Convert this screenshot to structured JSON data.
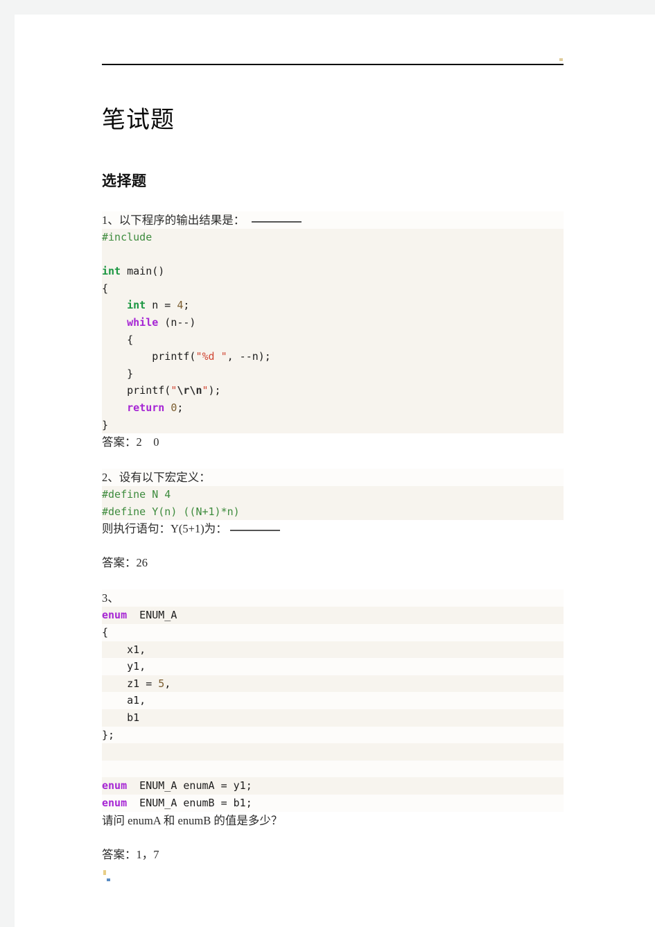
{
  "document": {
    "title": "笔试题",
    "section_title": "选择题"
  },
  "questions": [
    {
      "prompt_text": "1、以下程序的输出结果是：",
      "answer_label": "答案：2　0",
      "code": [
        [
          {
            "t": "#include",
            "c": "k-pre"
          }
        ],
        [
          {
            "t": "",
            "c": "k-plain"
          }
        ],
        [
          {
            "t": "int",
            "c": "k-type"
          },
          {
            "t": " main()",
            "c": "k-plain"
          }
        ],
        [
          {
            "t": "{",
            "c": "k-plain"
          }
        ],
        [
          {
            "t": "    ",
            "c": "k-plain"
          },
          {
            "t": "int",
            "c": "k-type"
          },
          {
            "t": " n = ",
            "c": "k-plain"
          },
          {
            "t": "4",
            "c": "k-num"
          },
          {
            "t": ";",
            "c": "k-plain"
          }
        ],
        [
          {
            "t": "    ",
            "c": "k-plain"
          },
          {
            "t": "while",
            "c": "k-kw"
          },
          {
            "t": " (n--)",
            "c": "k-plain"
          }
        ],
        [
          {
            "t": "    {",
            "c": "k-plain"
          }
        ],
        [
          {
            "t": "        printf(",
            "c": "k-plain"
          },
          {
            "t": "\"%d \"",
            "c": "k-str"
          },
          {
            "t": ", --n);",
            "c": "k-plain"
          }
        ],
        [
          {
            "t": "    }",
            "c": "k-plain"
          }
        ],
        [
          {
            "t": "    printf(",
            "c": "k-plain"
          },
          {
            "t": "\"",
            "c": "k-str"
          },
          {
            "t": "\\r\\n",
            "c": "k-esc"
          },
          {
            "t": "\"",
            "c": "k-str"
          },
          {
            "t": ");",
            "c": "k-plain"
          }
        ],
        [
          {
            "t": "    ",
            "c": "k-plain"
          },
          {
            "t": "return",
            "c": "k-kw"
          },
          {
            "t": " ",
            "c": "k-plain"
          },
          {
            "t": "0",
            "c": "k-num"
          },
          {
            "t": ";",
            "c": "k-plain"
          }
        ],
        [
          {
            "t": "}",
            "c": "k-plain"
          }
        ]
      ]
    },
    {
      "prompt_text": "2、设有以下宏定义：",
      "prompt_after": "则执行语句：Y(5+1)为：",
      "answer_label": "答案：26",
      "code": [
        [
          {
            "t": "#define N 4",
            "c": "k-pre"
          }
        ],
        [
          {
            "t": "#define Y(n) ((N+1)*n)",
            "c": "k-pre"
          }
        ]
      ]
    },
    {
      "prompt_text": "3、",
      "prompt_after": "请问 enumA 和 enumB 的值是多少？",
      "answer_label": "答案：1，7",
      "code": [
        [
          {
            "t": "enum",
            "c": "k-kw"
          },
          {
            "t": "  ENUM_A",
            "c": "k-plain"
          }
        ],
        [
          {
            "t": "{",
            "c": "k-plain"
          }
        ],
        [
          {
            "t": "    x1,",
            "c": "k-plain"
          }
        ],
        [
          {
            "t": "    y1,",
            "c": "k-plain"
          }
        ],
        [
          {
            "t": "    z1 = ",
            "c": "k-plain"
          },
          {
            "t": "5",
            "c": "k-num"
          },
          {
            "t": ",",
            "c": "k-plain"
          }
        ],
        [
          {
            "t": "    a1,",
            "c": "k-plain"
          }
        ],
        [
          {
            "t": "    b1",
            "c": "k-plain"
          }
        ],
        [
          {
            "t": "};",
            "c": "k-plain"
          }
        ],
        [
          {
            "t": "",
            "c": "k-plain"
          }
        ],
        [
          {
            "t": "",
            "c": "k-plain"
          }
        ],
        [
          {
            "t": "enum",
            "c": "k-kw"
          },
          {
            "t": "  ENUM_A enumA = y1;",
            "c": "k-plain"
          }
        ],
        [
          {
            "t": "enum",
            "c": "k-kw"
          },
          {
            "t": "  ENUM_A enumB = b1;",
            "c": "k-plain"
          }
        ]
      ]
    }
  ],
  "colors": {
    "page_background": "#f3f4f4",
    "sheet": "#ffffff",
    "code_background": "#f7f4ee",
    "code_background_alt": "#fdfcfa",
    "keyword": "#a626d4",
    "type": "#1a9641",
    "preprocessor": "#3d8b3d",
    "string": "#d14836",
    "text": "#2b2b2b",
    "rule": "#000000"
  }
}
